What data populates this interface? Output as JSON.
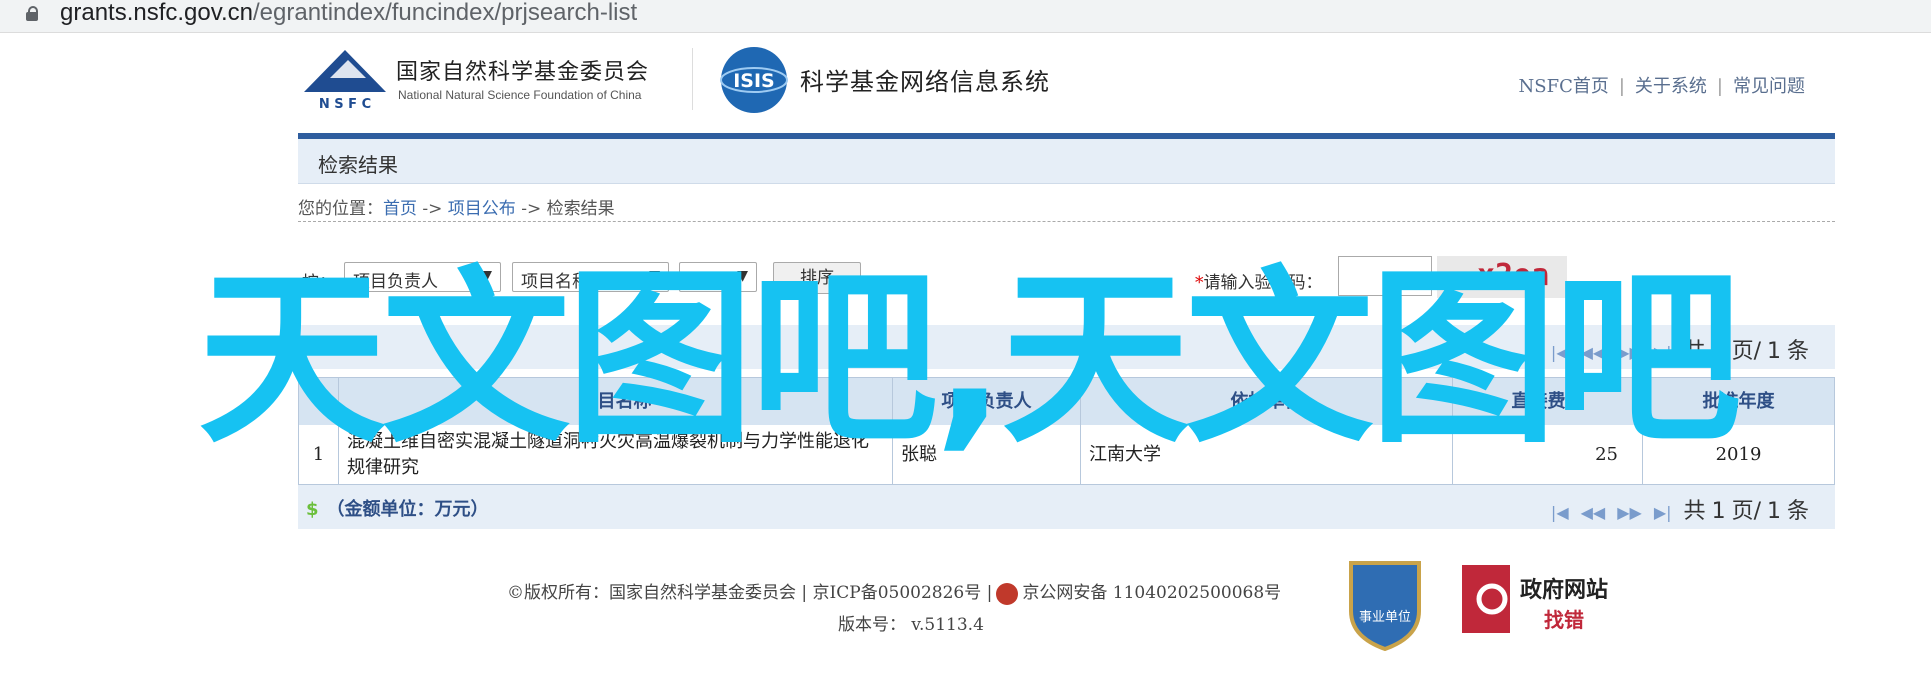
{
  "browser": {
    "url_host": "grants.nsfc.gov.cn",
    "url_path": "/egrantindex/funcindex/prjsearch-list"
  },
  "header": {
    "nsfc_logo_text": "N S F C",
    "org_name_cn": "国家自然科学基金委员会",
    "org_name_en": "National Natural Science Foundation of China",
    "isis_logo_text": "ISIS",
    "system_title": "科学基金网络信息系统",
    "nav": [
      "NSFC首页",
      "关于系统",
      "常见问题"
    ]
  },
  "section_title": "检索结果",
  "breadcrumb": {
    "prefix": "您的位置：",
    "items": [
      "首页",
      "项目公布",
      "检索结果"
    ],
    "sep": " -> "
  },
  "filters": {
    "sort_label": "按：",
    "sort_field_1": "项目负责人",
    "sort_field_2": "项目名称",
    "sort_order": "递减",
    "sort_button": "排序",
    "captcha_label": "请输入验证码：",
    "captcha_required_mark": "*",
    "captcha_image_text": "x2ea"
  },
  "pager": {
    "prefix": "共",
    "current": "1",
    "mid": "页/",
    "total": "1",
    "suffix": "条"
  },
  "table": {
    "headers": [
      "",
      "项目名称",
      "项目负责人",
      "依托单位",
      "直接费用",
      "批准年度"
    ],
    "rows": [
      {
        "index": "1",
        "name": "混凝土维自密实混凝土隧道洞衬火灾高温爆裂机制与力学性能退化规律研究",
        "leader": "张聪",
        "institution": "江南大学",
        "funding": "25",
        "year": "2019"
      }
    ]
  },
  "amount_unit": "（金额单位：万元）",
  "footer": {
    "copyright": "©版权所有：国家自然科学基金委员会 | 京ICP备05002826号 |",
    "police": "京公网安备 11040202500068号",
    "version_label": "版本号：",
    "version": "v.5113.4",
    "shield_text": "事业单位",
    "gov_line1": "政府网站",
    "gov_line2": "找错"
  },
  "watermark": "天文图吧,天文图吧"
}
